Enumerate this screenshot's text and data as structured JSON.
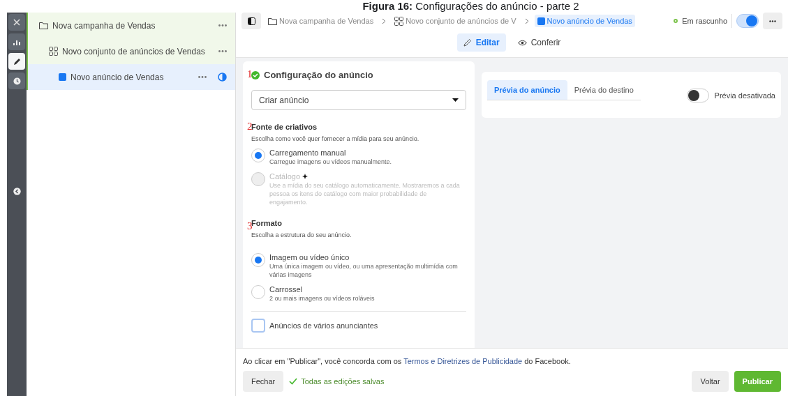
{
  "caption": "**Figura 16:** Configurações do anúncio - parte 2",
  "rail": [
    {
      "kind": "close",
      "selected": false
    },
    {
      "kind": "chart",
      "selected": false
    },
    {
      "kind": "edit",
      "selected": true
    },
    {
      "kind": "clock",
      "selected": false
    }
  ],
  "tree": [
    {
      "kind": "campaign",
      "label": "Nova campanha de Vendas",
      "selected": false,
      "children": [
        {
          "kind": "adset",
          "label": "Novo conjunto de anúncios de Vendas",
          "selected": false,
          "children": [
            {
              "kind": "ad",
              "label": "Novo anúncio de Vendas",
              "selected": true
            }
          ]
        }
      ]
    }
  ],
  "breadcrumb": [
    {
      "kind": "campaign",
      "label": "Nova campanha de Vendas",
      "selected": false
    },
    {
      "kind": "adset",
      "label": "Novo conjunto de anúncios de V",
      "selected": false
    },
    {
      "kind": "ad",
      "label": "Novo anúncio de Vendas",
      "selected": true
    }
  ],
  "status": {
    "label": "Em rascunho",
    "on": true
  },
  "mode_tabs": [
    {
      "kind": "edit",
      "label": "Editar",
      "selected": true
    },
    {
      "kind": "review",
      "label": "Conferir",
      "selected": false
    }
  ],
  "form": {
    "annotations": [
      "1",
      "2",
      "3"
    ],
    "section_title": "Configuração do anúncio",
    "dropdown": {
      "value": "Criar anúncio"
    },
    "creative_source": {
      "title": "Fonte de criativos",
      "hint": "Escolha como você quer fornecer a mídia para seu anúncio.",
      "options": [
        {
          "label": "Carregamento manual",
          "description": "Carregue imagens ou vídeos manualmente.",
          "selected": true,
          "disabled": false
        },
        {
          "kind": "sparkle",
          "label": "Catálogo",
          "description": "Use a mídia do seu catálogo automaticamente. Mostraremos a cada pessoa os itens do catálogo com maior probabilidade de engajamento.",
          "selected": false,
          "disabled": true
        }
      ]
    },
    "format": {
      "title": "Formato",
      "hint": "Escolha a estrutura do seu anúncio.",
      "options": [
        {
          "label": "Imagem ou vídeo único",
          "description": "Uma única imagem ou vídeo, ou uma apresentação multimídia com várias imagens",
          "selected": true,
          "disabled": false
        },
        {
          "label": "Carrossel",
          "description": "2 ou mais imagens ou vídeos roláveis",
          "selected": false,
          "disabled": false
        }
      ]
    },
    "multi_advertiser": {
      "label": "Anúncios de vários anunciantes",
      "checked": false
    }
  },
  "preview": {
    "tabs": [
      {
        "label": "Prévia do anúncio",
        "selected": true
      },
      {
        "label": "Prévia do destino",
        "selected": false
      }
    ],
    "toggle": {
      "label": "Prévia desativada",
      "on": false
    }
  },
  "footer": {
    "notice": "Ao clicar em \"Publicar\", você concorda com os ",
    "link": "Termos e Diretrizes de Publicidade",
    "notice_end": " do Facebook.",
    "close": "Fechar",
    "saved": "Todas as edições salvas",
    "back": "Voltar",
    "publish": "Publicar"
  }
}
